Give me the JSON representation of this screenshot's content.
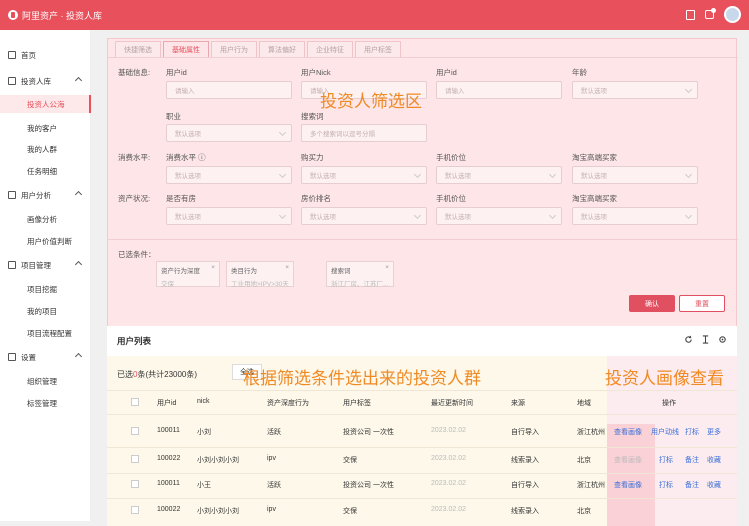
{
  "app": {
    "title": "阿里资产 · 投资人库"
  },
  "sidebar": {
    "items": [
      {
        "label": "首页",
        "icon": "home-icon"
      },
      {
        "label": "投资人库",
        "icon": "user-icon",
        "group": true
      },
      {
        "label": "投资人公海",
        "active": true
      },
      {
        "label": "我的客户"
      },
      {
        "label": "我的人群"
      },
      {
        "label": "任务明细"
      },
      {
        "label": "用户分析",
        "icon": "analysis-icon",
        "group": true
      },
      {
        "label": "画像分析"
      },
      {
        "label": "用户价值判断"
      },
      {
        "label": "项目管理",
        "icon": "project-icon",
        "group": true
      },
      {
        "label": "项目挖掘"
      },
      {
        "label": "我的项目"
      },
      {
        "label": "项目流程配置"
      },
      {
        "label": "设置",
        "icon": "settings-icon",
        "group": true
      },
      {
        "label": "组织管理"
      },
      {
        "label": "标签管理"
      }
    ]
  },
  "filter": {
    "tabs": [
      "快捷筛选",
      "基础属性",
      "用户行为",
      "算法偏好",
      "企业特征",
      "用户标签"
    ],
    "rows": [
      {
        "section": "基础信息:",
        "fields": [
          {
            "label": "用户id",
            "placeholder": "请输入"
          },
          {
            "label": "用户Nick",
            "placeholder": "请输入"
          },
          {
            "label": "用户id",
            "placeholder": "请输入"
          },
          {
            "label": "年龄",
            "placeholder": "默认选项"
          }
        ]
      },
      {
        "section": "",
        "fields": [
          {
            "label": "职业",
            "placeholder": "默认选项"
          },
          {
            "label": "搜索词",
            "placeholder": "多个搜索词以逗号分隔"
          }
        ]
      },
      {
        "section": "消费水平:",
        "fields": [
          {
            "label": "消费水平 ⓘ",
            "placeholder": "默认选项"
          },
          {
            "label": "购买力",
            "placeholder": "默认选项"
          },
          {
            "label": "手机价位",
            "placeholder": "默认选项"
          },
          {
            "label": "淘宝高端买家",
            "placeholder": "默认选项"
          }
        ]
      },
      {
        "section": "资产状况:",
        "fields": [
          {
            "label": "是否有房",
            "placeholder": "默认选项"
          },
          {
            "label": "房价排名",
            "placeholder": "默认选项"
          },
          {
            "label": "手机价位",
            "placeholder": "默认选项"
          },
          {
            "label": "淘宝高端买家",
            "placeholder": "默认选项"
          }
        ]
      }
    ],
    "conditions_label": "已选条件：",
    "conditions": [
      {
        "name": "资产行为深度",
        "value": "交保"
      },
      {
        "name": "类目行为",
        "value": "工业用地>IPV>30天..."
      },
      {
        "name": "搜索词",
        "value": "浙江厂房、江苏厂..."
      }
    ],
    "confirm_label": "确认",
    "reset_label": "重置",
    "overlay_label": "投资人筛选区"
  },
  "list": {
    "title": "用户列表",
    "selected_prefix": "已选",
    "selected_count": "0",
    "selected_suffix": "条(共计23000条)",
    "select_all_label": "全选",
    "overlay_left": "根据筛选条件选出来的投资人群",
    "overlay_right": "投资人画像查看",
    "columns": [
      "用户id",
      "nick",
      "资产深度行为",
      "用户标签",
      "最近更新时间",
      "来源",
      "地域",
      "操作"
    ],
    "rows": [
      {
        "id": "100011",
        "nick": "小刘",
        "depth": "活跃",
        "tags": "投资公司 一次性",
        "time": "2023.02.02",
        "source": "自行导入",
        "region": "浙江杭州",
        "actions": [
          "查看画像",
          "用户动线",
          "打标",
          "更多"
        ]
      },
      {
        "id": "100022",
        "nick": "小刘小刘小刘",
        "depth": "ipv",
        "tags": "交保",
        "time": "2023.02.02",
        "source": "线索录入",
        "region": "北京",
        "actions": [
          "查看画像",
          "打标",
          "备注",
          "收藏"
        ]
      },
      {
        "id": "100011",
        "nick": "小王",
        "depth": "活跃",
        "tags": "投资公司 一次性",
        "time": "2023.02.02",
        "source": "自行导入",
        "region": "浙江杭州",
        "actions": [
          "查看画像",
          "打标",
          "备注",
          "收藏"
        ]
      },
      {
        "id": "100022",
        "nick": "小刘小刘小刘",
        "depth": "ipv",
        "tags": "交保",
        "time": "2023.02.02",
        "source": "线索录入",
        "region": "北京",
        "actions": [
          "",
          "",
          "",
          ""
        ]
      }
    ]
  }
}
